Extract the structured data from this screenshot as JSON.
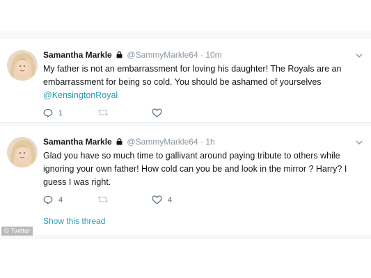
{
  "tweets": [
    {
      "author_name": "Samantha Markle",
      "handle": "@SammyMarkle64",
      "separator": "·",
      "time": "10m",
      "text_lines": [
        "My father is not an  embarrassment for loving his daughter! The Royals are an",
        "embarrassment for being so cold. You should be ashamed of yourselves"
      ],
      "mention": "@KensingtonRoyal",
      "reply_count": "1",
      "retweet_count": "",
      "like_count": ""
    },
    {
      "author_name": "Samantha Markle",
      "handle": "@SammyMarkle64",
      "separator": "·",
      "time": "1h",
      "text_lines": [
        "Glad you have so much time to gallivant around paying tribute to others while",
        "ignoring your own father! How cold can you be and look in the mirror ? Harry? I",
        "guess I was right."
      ],
      "reply_count": "4",
      "retweet_count": "",
      "like_count": "4",
      "show_thread_label": "Show this thread"
    }
  ],
  "credit": "© Twitter",
  "colors": {
    "link": "#2a9ab3",
    "muted": "#8a96a0",
    "text": "#14171a"
  },
  "icons": {
    "lock": "lock-icon",
    "caret": "chevron-down-icon",
    "reply": "reply-icon",
    "retweet": "retweet-icon",
    "like": "heart-icon"
  }
}
